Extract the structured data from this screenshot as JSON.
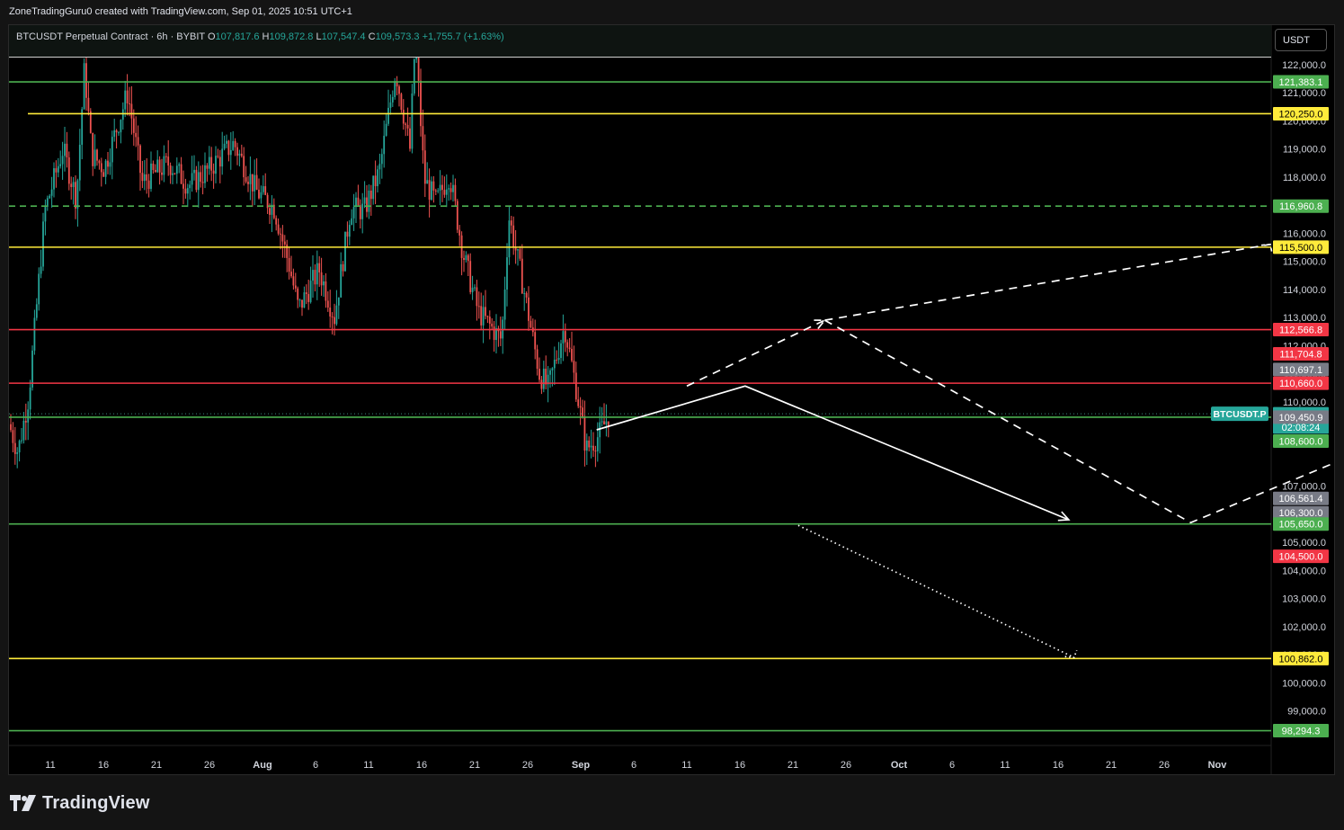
{
  "header": {
    "credit": "ZoneTradingGuru0 created with TradingView.com, Sep 01, 2025 10:51 UTC+1"
  },
  "symbol": {
    "name": "BTCUSDT Perpetual Contract · 6h · BYBIT",
    "o_key": "O",
    "o_val": "107,817.6",
    "h_key": "H",
    "h_val": "109,872.8",
    "l_key": "L",
    "l_val": "107,547.4",
    "c_key": "C",
    "c_val": "109,573.3",
    "change": "+1,755.7 (+1.63%)"
  },
  "currency": "USDT",
  "footer": {
    "brand": "TradingView"
  },
  "colors": {
    "up": "#26a69a",
    "down": "#ef5350",
    "green_line": "#4caf50",
    "red_line": "#f23645",
    "yellow_line": "#ffeb3b",
    "gray_label": "#7a7a7a"
  },
  "chart_data": {
    "type": "candlestick",
    "symbol": "BTCUSDT.P",
    "timeframe": "6h",
    "ylim": [
      97800,
      123400
    ],
    "x_ticks": [
      "11",
      "16",
      "21",
      "26",
      "Aug",
      "6",
      "11",
      "16",
      "21",
      "26",
      "Sep",
      "6",
      "11",
      "16",
      "21",
      "26",
      "Oct",
      "6",
      "11",
      "16",
      "21",
      "26",
      "Nov"
    ],
    "y_ticks": [
      "122,000.0",
      "121,000.0",
      "120,000.0",
      "119,000.0",
      "118,000.0",
      "117,000.0",
      "116,000.0",
      "115,000.0",
      "114,000.0",
      "113,000.0",
      "112,000.0",
      "111,000.0",
      "110,000.0",
      "107,000.0",
      "105,000.0",
      "104,000.0",
      "103,000.0",
      "102,000.0",
      "101,000.0",
      "100,000.0",
      "99,000.0"
    ],
    "y_tick_values": [
      122000,
      121000,
      120000,
      119000,
      118000,
      117000,
      116000,
      115000,
      114000,
      113000,
      112000,
      111000,
      110000,
      107000,
      105000,
      104000,
      103000,
      102000,
      101000,
      100000,
      99000
    ],
    "horizontal_levels": [
      {
        "price": 123200,
        "color": "red"
      },
      {
        "price": 121383.1,
        "color": "green"
      },
      {
        "price": 120250.0,
        "color": "yellow"
      },
      {
        "price": 116960.8,
        "color": "green",
        "dashed": true
      },
      {
        "price": 115500.0,
        "color": "yellow"
      },
      {
        "price": 112566.8,
        "color": "red"
      },
      {
        "price": 110660.0,
        "color": "red"
      },
      {
        "price": 109450.9,
        "color": "green"
      },
      {
        "price": 105650.0,
        "color": "green"
      },
      {
        "price": 100862.0,
        "color": "yellow"
      },
      {
        "price": 98294.3,
        "color": "green"
      }
    ],
    "price_labels": [
      {
        "text": "121,383.1",
        "price": 121383.1,
        "bg": "green"
      },
      {
        "text": "120,250.0",
        "price": 120250.0,
        "bg": "yellow"
      },
      {
        "text": "116,960.8",
        "price": 116960.8,
        "bg": "green"
      },
      {
        "text": "115,500.0",
        "price": 115500.0,
        "bg": "yellow"
      },
      {
        "text": "112,566.8",
        "price": 112566.8,
        "bg": "red"
      },
      {
        "text": "111,704.8",
        "price": 111704.8,
        "bg": "red"
      },
      {
        "text": "110,697.1",
        "price": 111150.0,
        "bg": "gray"
      },
      {
        "text": "110,660.0",
        "price": 110660.0,
        "bg": "red"
      },
      {
        "text": "109,573.3",
        "price": 109573.3,
        "bg": "up"
      },
      {
        "text": "02:08:24",
        "price": 109100.0,
        "bg": "up"
      },
      {
        "text": "109,450.9",
        "price": 109450.9,
        "bg": "gray"
      },
      {
        "text": "108,600.0",
        "price": 108600.0,
        "bg": "green"
      },
      {
        "text": "106,561.4",
        "price": 106561.4,
        "bg": "gray"
      },
      {
        "text": "106,300.0",
        "price": 106050.0,
        "bg": "gray"
      },
      {
        "text": "105,650.0",
        "price": 105650.0,
        "bg": "green"
      },
      {
        "text": "104,500.0",
        "price": 104500.0,
        "bg": "red"
      },
      {
        "text": "100,862.0",
        "price": 100862.0,
        "bg": "yellow"
      },
      {
        "text": "98,294.3",
        "price": 98294.3,
        "bg": "green"
      }
    ],
    "symbol_tag": "BTCUSDT.P",
    "last_price": 109573.3,
    "path_waypoints": {
      "solid": [
        [
          0,
          109000
        ],
        [
          2.8,
          110560
        ],
        [
          8.9,
          105800
        ]
      ],
      "dashed_a": [
        [
          2.2,
          110560
        ],
        [
          4.8,
          112900
        ],
        [
          13.2,
          115600
        ]
      ],
      "dashed_b": [
        [
          4.8,
          112900
        ],
        [
          11.7,
          105700
        ]
      ],
      "dashed_c": [
        [
          11.7,
          105700
        ],
        [
          24.2,
          115500
        ]
      ],
      "dotted_a": [
        [
          24.2,
          115500
        ],
        [
          28.2,
          117020
        ],
        [
          30.6,
          115500
        ],
        [
          35.4,
          120000
        ]
      ],
      "dotted_b": [
        [
          12.3,
          105600
        ],
        [
          17.5,
          100900
        ]
      ]
    }
  }
}
